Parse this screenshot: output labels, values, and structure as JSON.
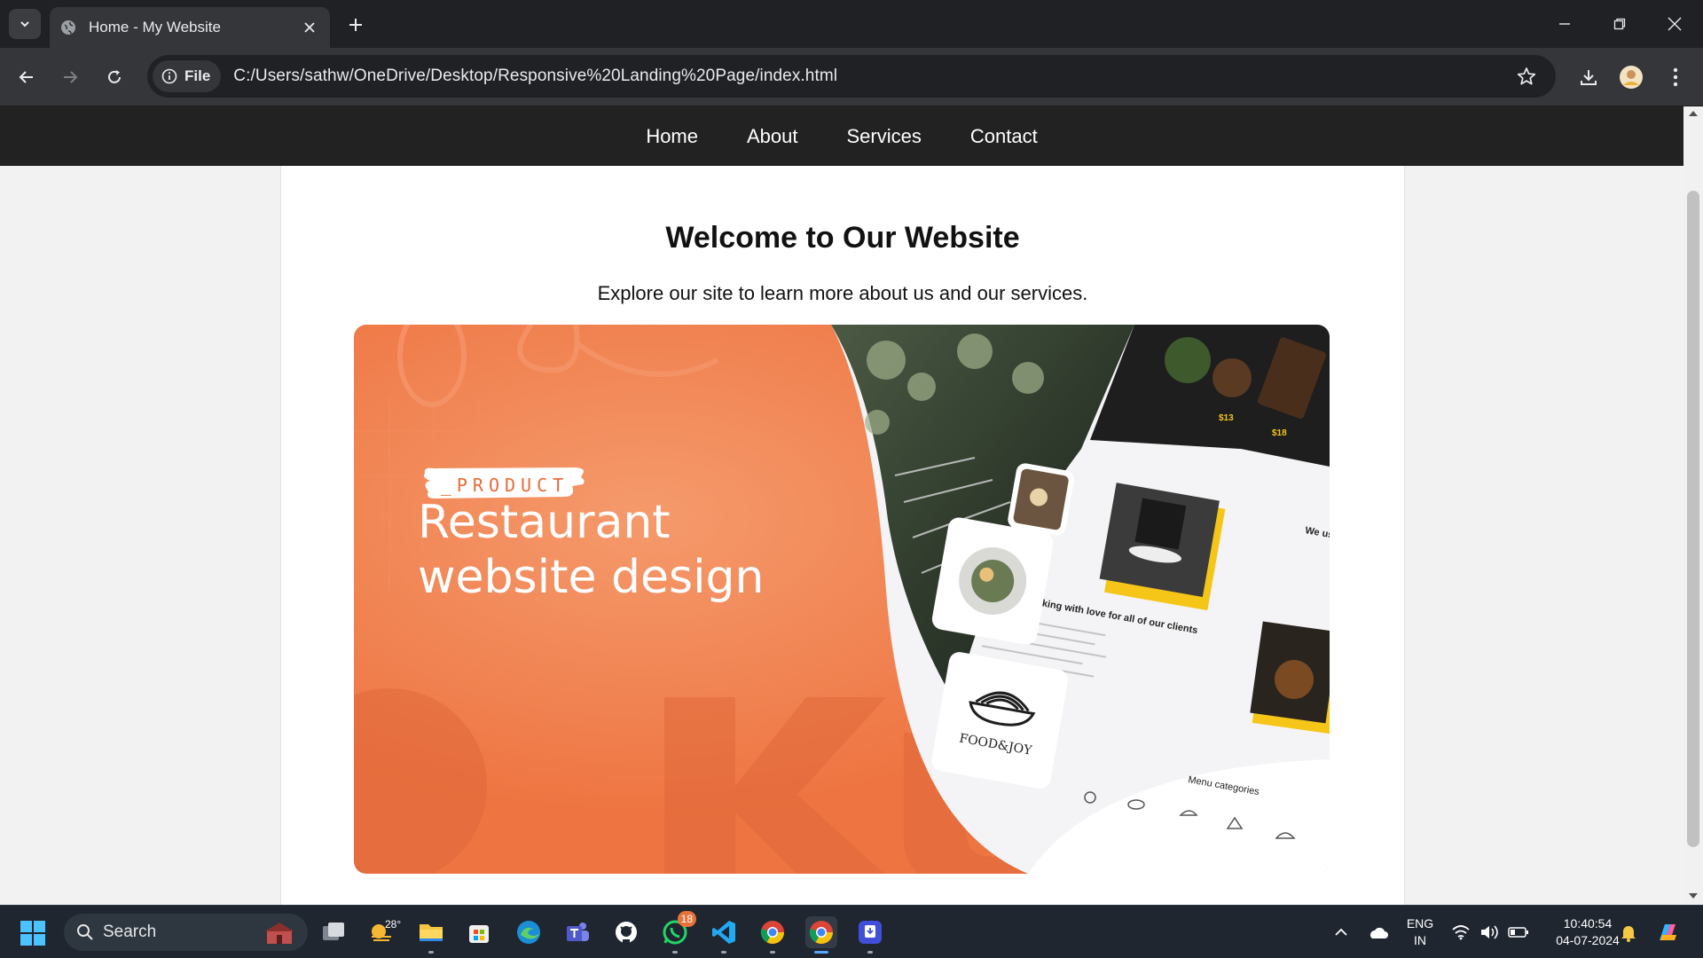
{
  "browser": {
    "tab_title": "Home - My Website",
    "omnibox_chip": "File",
    "url": "C:/Users/sathw/OneDrive/Desktop/Responsive%20Landing%20Page/index.html"
  },
  "site": {
    "nav": [
      {
        "label": "Home"
      },
      {
        "label": "About"
      },
      {
        "label": "Services"
      },
      {
        "label": "Contact"
      }
    ],
    "headline": "Welcome to Our Website",
    "subtitle": "Explore our site to learn more about us and our services."
  },
  "hero": {
    "tag": "_PRODUCT",
    "title_line1": "Restaurant",
    "title_line2": "website design",
    "logo_text": "FOOD&JOY",
    "mock_heading": "We are cooking with love for all of our clients",
    "mock_side": "We us ingred",
    "menu_categories": "Menu categories",
    "price1": "$13",
    "price2": "$18",
    "colors": {
      "orange": "#ee7441",
      "yellow": "#f5c518",
      "dark": "#1e1e1e"
    }
  },
  "taskbar": {
    "search_label": "Search",
    "weather_temp": "28°",
    "whatsapp_badge": "18",
    "language_line1": "ENG",
    "language_line2": "IN",
    "time": "10:40:54",
    "date": "04-07-2024"
  }
}
